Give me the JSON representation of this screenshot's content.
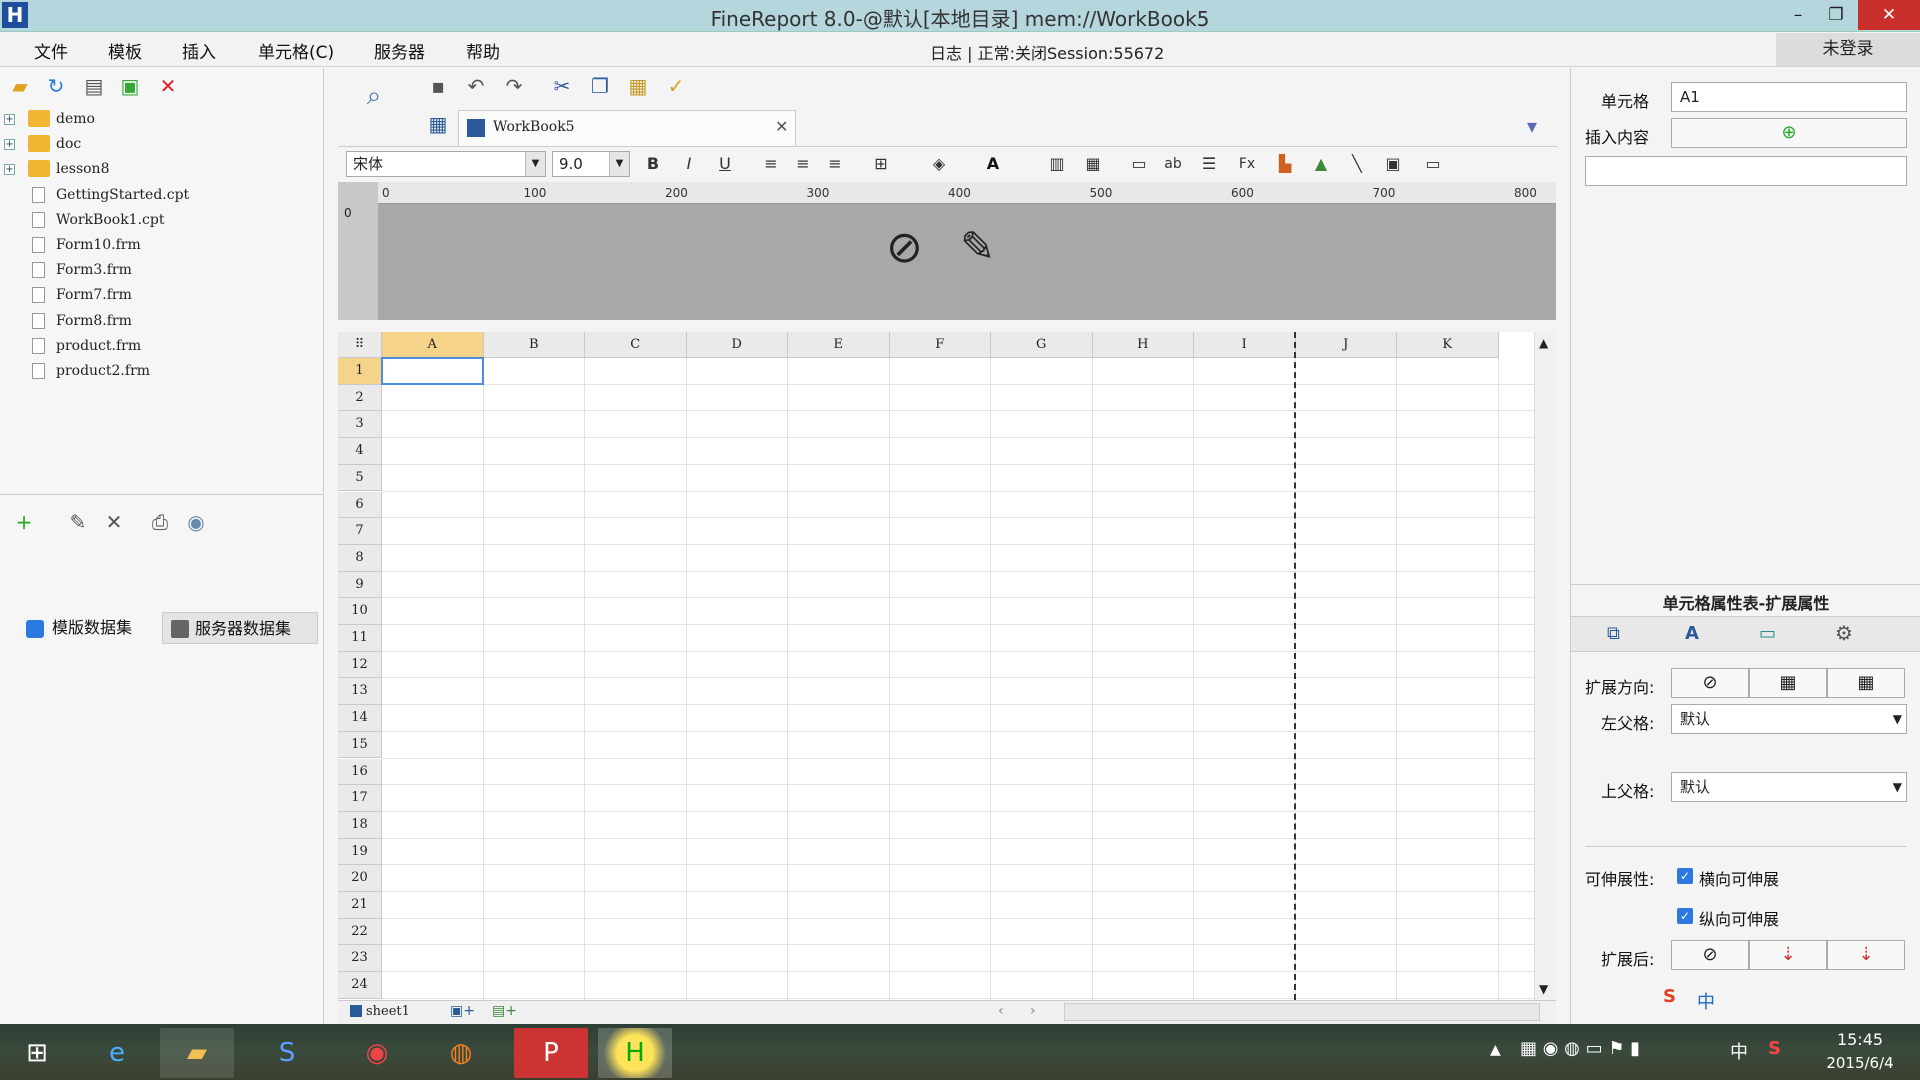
{
  "window": {
    "title": "FineReport 8.0-@默认[本地目录]    mem://WorkBook5",
    "minimize": "–",
    "maximize": "❐",
    "close": "✕"
  },
  "menu": {
    "items": [
      "文件",
      "模板",
      "插入",
      "单元格(C)",
      "服务器",
      "帮助"
    ],
    "status": "日志 | 正常:关闭Session:55672",
    "login": "未登录"
  },
  "tree": [
    {
      "label": "demo",
      "type": "folder"
    },
    {
      "label": "doc",
      "type": "folder"
    },
    {
      "label": "lesson8",
      "type": "folder"
    },
    {
      "label": "GettingStarted.cpt",
      "type": "file"
    },
    {
      "label": "WorkBook1.cpt",
      "type": "file"
    },
    {
      "label": "Form10.frm",
      "type": "file"
    },
    {
      "label": "Form3.frm",
      "type": "file"
    },
    {
      "label": "Form7.frm",
      "type": "file"
    },
    {
      "label": "Form8.frm",
      "type": "file"
    },
    {
      "label": "product.frm",
      "type": "file"
    },
    {
      "label": "product2.frm",
      "type": "file"
    }
  ],
  "dataset_tabs": [
    "模版数据集",
    "服务器数据集"
  ],
  "editor": {
    "tab_label": "WorkBook5",
    "font_name": "宋体",
    "font_size": "9.0",
    "sheet_label": "sheet1"
  },
  "ruler": {
    "ticks": [
      "0",
      "100",
      "200",
      "300",
      "400",
      "500",
      "600",
      "700",
      "800"
    ]
  },
  "grid": {
    "columns": [
      "A",
      "B",
      "C",
      "D",
      "E",
      "F",
      "G",
      "H",
      "I",
      "J",
      "K"
    ],
    "rows": [
      "1",
      "2",
      "3",
      "4",
      "5",
      "6",
      "7",
      "8",
      "9",
      "10",
      "11",
      "12",
      "13",
      "14",
      "15",
      "16",
      "17",
      "18",
      "19",
      "20",
      "21",
      "22",
      "23",
      "24"
    ],
    "selected_cell": "A1"
  },
  "right": {
    "cell_label": "单元格",
    "cell_value": "A1",
    "insert_label": "插入内容",
    "props_title": "单元格属性表-扩展属性",
    "expand_dir_label": "扩展方向:",
    "left_parent_label": "左父格:",
    "left_parent_value": "默认",
    "top_parent_label": "上父格:",
    "top_parent_value": "默认",
    "stretch_label": "可伸展性:",
    "stretch_h": "横向可伸展",
    "stretch_v": "纵向可伸展",
    "after_label": "扩展后:"
  },
  "clock": {
    "time": "15:45",
    "date": "2015/6/4"
  },
  "ime": "中"
}
